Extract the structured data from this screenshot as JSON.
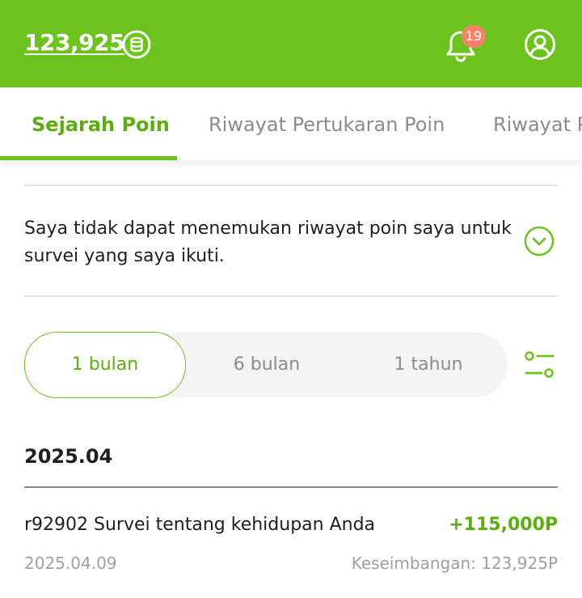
{
  "header": {
    "points_balance": "123,925",
    "notification_count": "19",
    "colors": {
      "brand": "#6cc31b",
      "badge": "#f5836a"
    },
    "icons": [
      "coin-icon",
      "bell-icon",
      "user-profile-icon"
    ]
  },
  "tabs": [
    {
      "label": "Sejarah Poin",
      "active": true
    },
    {
      "label": "Riwayat Pertukaran Poin",
      "active": false
    },
    {
      "label": "Riwayat Pe",
      "active": false
    }
  ],
  "faq": {
    "question": "Saya tidak dapat menemukan riwayat poin saya untuk survei yang saya ikuti.",
    "icon": "chevron-down-circle-icon"
  },
  "period_filter": {
    "options": [
      "1 bulan",
      "6 bulan",
      "1 tahun"
    ],
    "selected": "1 bulan",
    "icon": "filter-settings-icon"
  },
  "history": {
    "month": "2025.04",
    "transactions": [
      {
        "title": "r92902 Survei tentang kehidupan Anda",
        "amount": "+115,000P",
        "date": "2025.04.09",
        "balance_label": "Keseimbangan:",
        "balance_value": "123,925P"
      }
    ]
  }
}
